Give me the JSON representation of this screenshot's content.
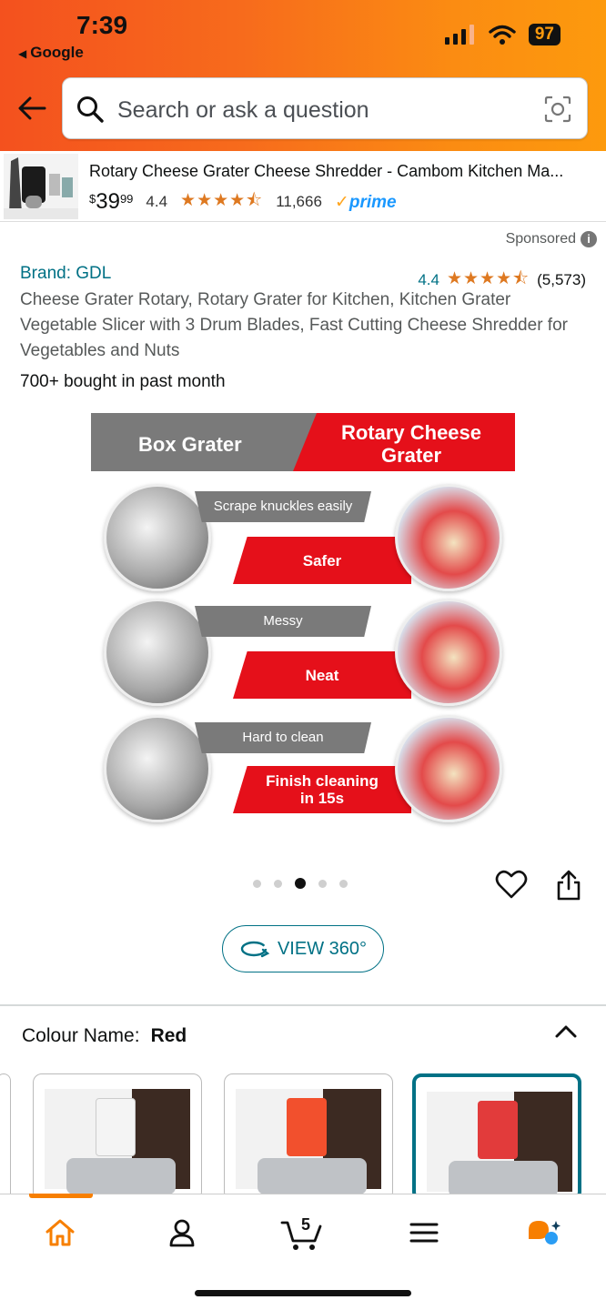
{
  "status_bar": {
    "time": "7:39",
    "back_app": "Google",
    "battery": "97"
  },
  "search": {
    "placeholder": "Search or ask a question"
  },
  "sticky_product": {
    "title": "Rotary Cheese Grater Cheese Shredder - Cambom Kitchen Ma...",
    "price_symbol": "$",
    "price_whole": "39",
    "price_cents": "99",
    "rating": "4.4",
    "stars": "★★★★⯪",
    "reviews": "11,666",
    "prime_check": "✓",
    "prime_label": "prime"
  },
  "listing": {
    "sponsored": "Sponsored",
    "sponsored_info": "i",
    "brand": "Brand: GDL",
    "rating": "4.4",
    "stars": "★★★★⯪",
    "reviews": "(5,573)",
    "title": "Cheese Grater Rotary, Rotary Grater for Kitchen, Kitchen Grater Vegetable Slicer with 3 Drum Blades, Fast Cutting Cheese Shredder for Vegetables and Nuts",
    "bought": "700+ bought in past month"
  },
  "infographic": {
    "left_header": "Box Grater",
    "right_header": "Rotary Cheese Grater",
    "rows": [
      {
        "con": "Scrape knuckles easily",
        "pro": "Safer"
      },
      {
        "con": "Messy",
        "pro": "Neat"
      },
      {
        "con": "Hard to clean",
        "pro": "Finish cleaning in 15s"
      }
    ]
  },
  "carousel": {
    "total": 5,
    "active": 2
  },
  "view360": {
    "label": "VIEW 360°"
  },
  "colour": {
    "label": "Colour Name:",
    "value": "Red",
    "swatches": [
      {
        "name": "white",
        "color": "#f4f4f4",
        "selected": false
      },
      {
        "name": "orange",
        "color": "#f2502d",
        "selected": false
      },
      {
        "name": "red",
        "color": "#e23b3b",
        "selected": true
      }
    ]
  },
  "tabbar": {
    "items": [
      "home-icon",
      "account-icon",
      "cart-icon",
      "menu-icon",
      "rufus-icon"
    ],
    "cart_count": "5",
    "accent": "#f77f00"
  },
  "colors": {
    "accent": "#f77f00",
    "link": "#007185",
    "star": "#de7921",
    "sale_red": "#e5101a"
  }
}
